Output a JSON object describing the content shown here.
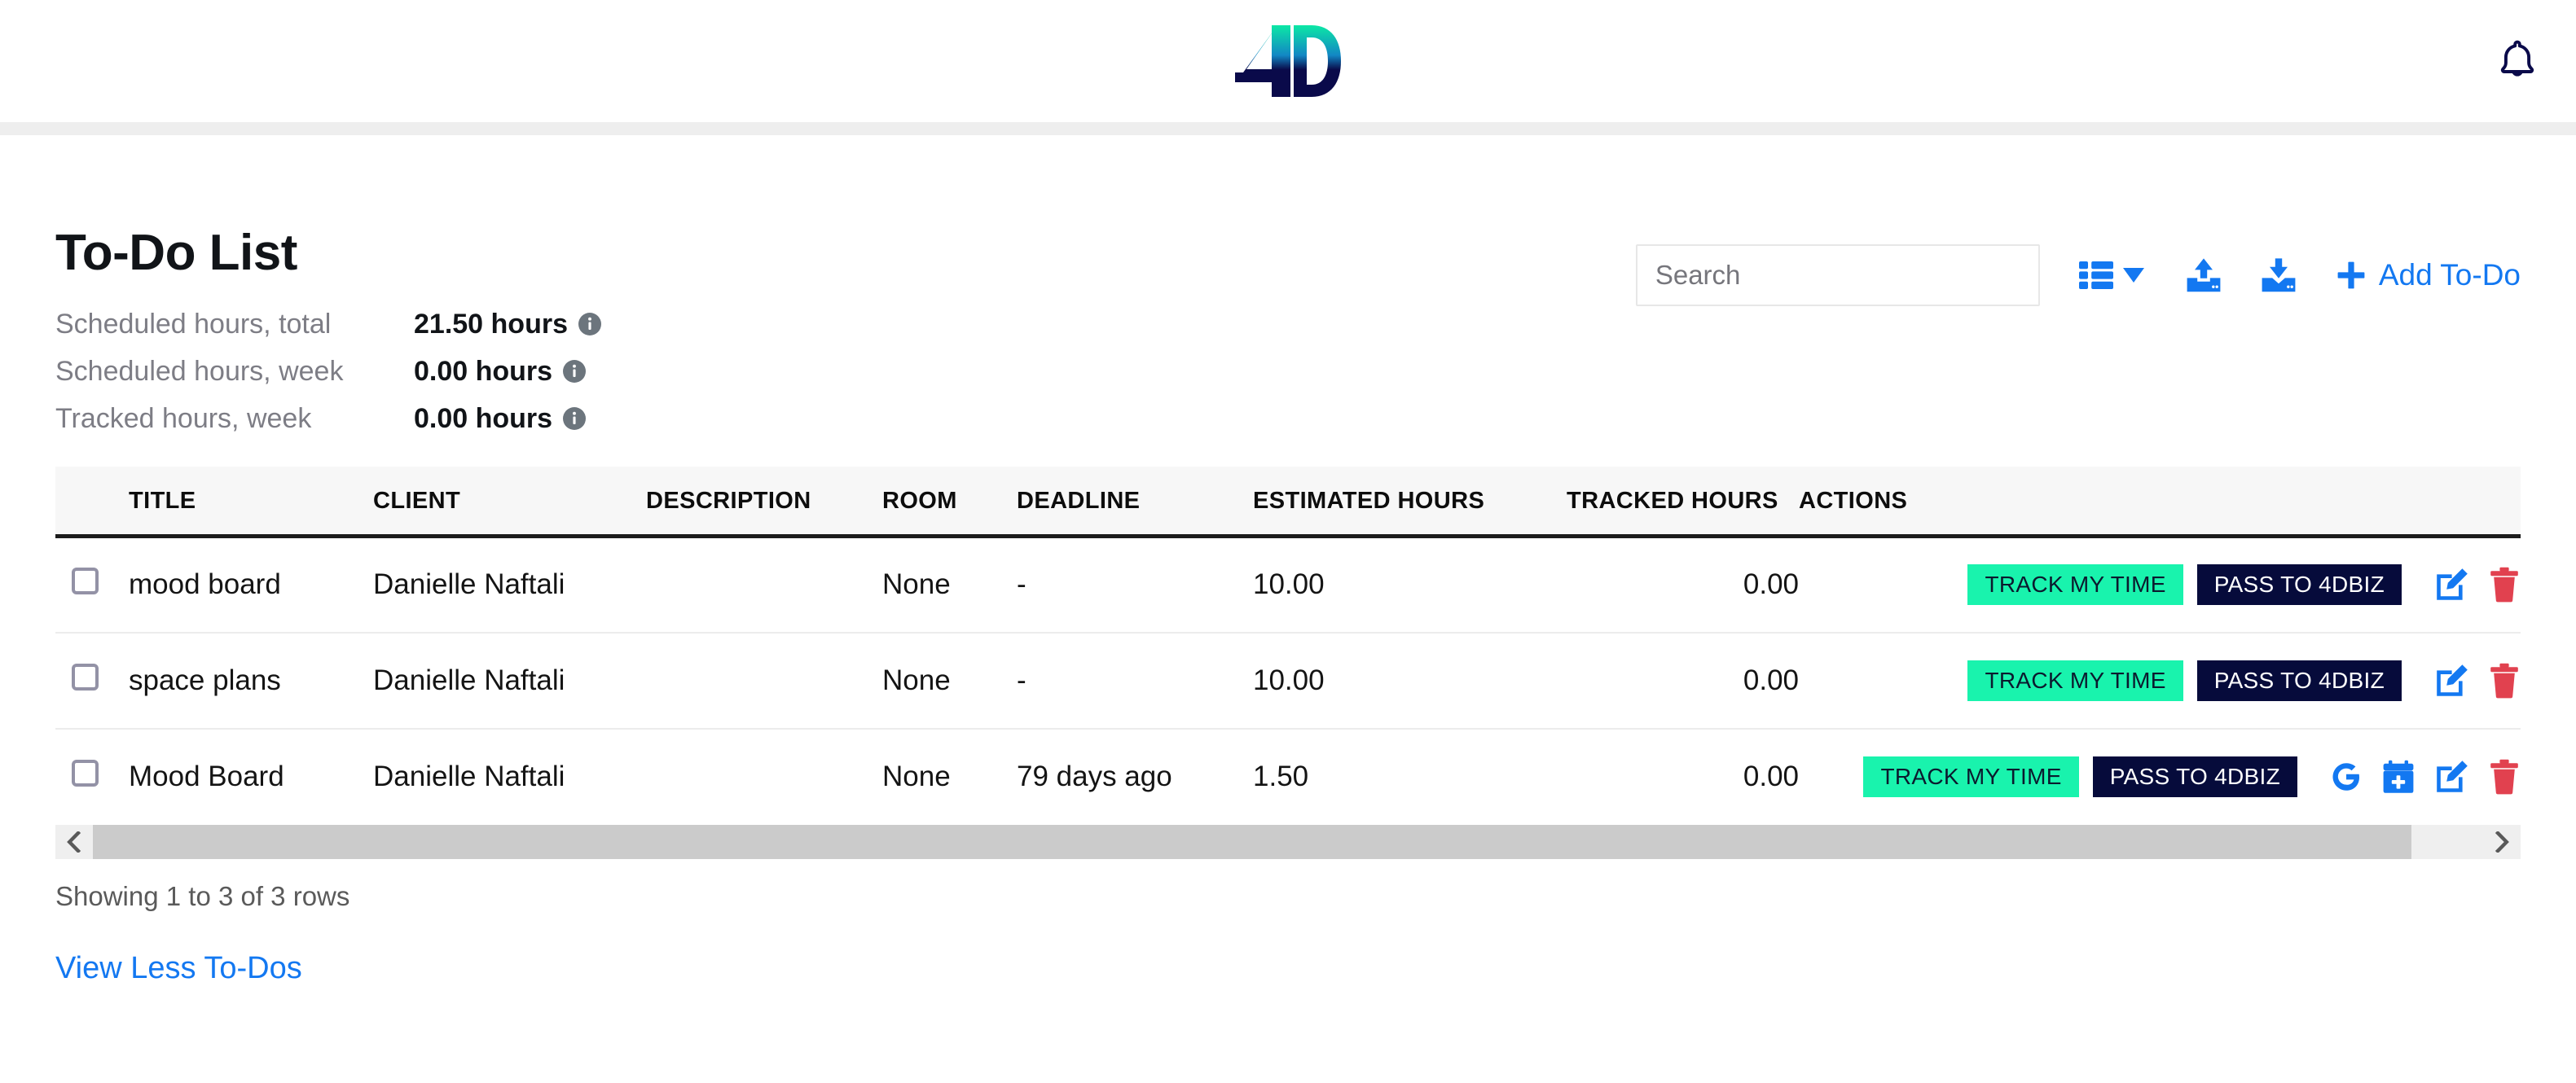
{
  "header": {
    "logo_text": "4D",
    "logo_colors": {
      "top": "#0ce8a5",
      "mid": "#1287c4",
      "bottom": "#0a0a4a"
    },
    "bell_icon": "bell-icon"
  },
  "page": {
    "title": "To-Do List"
  },
  "stats": [
    {
      "label": "Scheduled hours, total",
      "value": "21.50 hours",
      "info_icon": "info-icon"
    },
    {
      "label": "Scheduled hours, week",
      "value": "0.00 hours",
      "info_icon": "info-icon"
    },
    {
      "label": "Tracked hours, week",
      "value": "0.00 hours",
      "info_icon": "info-icon"
    }
  ],
  "toolbar": {
    "search_placeholder": "Search",
    "search_value": "",
    "columns_icon": "columns-grid-icon",
    "columns_caret_icon": "caret-down-icon",
    "upload_icon": "upload-icon",
    "download_icon": "download-icon",
    "add_icon": "plus-icon",
    "add_label": "Add To-Do"
  },
  "table": {
    "columns": [
      {
        "key": "check",
        "label": ""
      },
      {
        "key": "title",
        "label": "TITLE"
      },
      {
        "key": "client",
        "label": "CLIENT"
      },
      {
        "key": "description",
        "label": "DESCRIPTION"
      },
      {
        "key": "room",
        "label": "ROOM"
      },
      {
        "key": "deadline",
        "label": "DEADLINE"
      },
      {
        "key": "estimated_hours",
        "label": "ESTIMATED HOURS"
      },
      {
        "key": "tracked_hours",
        "label": "TRACKED HOURS"
      },
      {
        "key": "actions",
        "label": "ACTIONS"
      }
    ],
    "rows": [
      {
        "checked": false,
        "title": "mood board",
        "client": "Danielle Naftali",
        "description": "",
        "room": "None",
        "deadline": "-",
        "deadline_overdue": false,
        "estimated_hours": "10.00",
        "tracked_hours": "0.00",
        "track_label": "TRACK MY TIME",
        "pass_label": "PASS TO 4DBIZ",
        "has_google": false,
        "has_calendar": false
      },
      {
        "checked": false,
        "title": "space plans",
        "client": "Danielle Naftali",
        "description": "",
        "room": "None",
        "deadline": "-",
        "deadline_overdue": false,
        "estimated_hours": "10.00",
        "tracked_hours": "0.00",
        "track_label": "TRACK MY TIME",
        "pass_label": "PASS TO 4DBIZ",
        "has_google": false,
        "has_calendar": false
      },
      {
        "checked": false,
        "title": "Mood Board",
        "client": "Danielle Naftali",
        "description": "",
        "room": "None",
        "deadline": "79 days ago",
        "deadline_overdue": true,
        "estimated_hours": "1.50",
        "tracked_hours": "0.00",
        "track_label": "TRACK MY TIME",
        "pass_label": "PASS TO 4DBIZ",
        "has_google": true,
        "has_calendar": true
      }
    ]
  },
  "scrollbar": {
    "left_arrow": "chevron-left-icon",
    "right_arrow": "chevron-right-icon"
  },
  "footer": {
    "showing": "Showing 1 to 3 of 3 rows",
    "view_less_label": "View Less To-Dos"
  },
  "colors": {
    "accent_blue": "#1378f1",
    "track_green": "#19f3ad",
    "pass_navy": "#060b3b",
    "danger_red": "#e13a4b",
    "overdue_red": "#e13a4b"
  }
}
